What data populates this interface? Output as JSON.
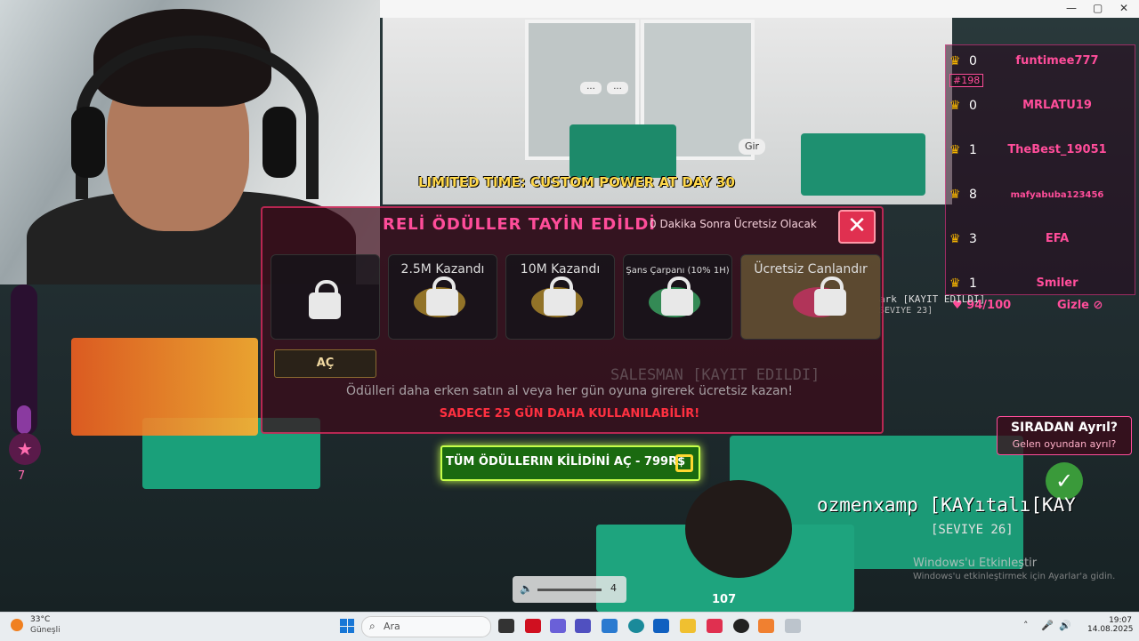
{
  "window": {
    "minimize": "—",
    "maximize": "▢",
    "close": "✕"
  },
  "leaderboard": {
    "rows": [
      {
        "score": "0",
        "name": "funtimee777",
        "rank": "#198"
      },
      {
        "score": "0",
        "name": "MRLATU19"
      },
      {
        "score": "1",
        "name": "TheBest_19051"
      },
      {
        "score": "8",
        "name": "mafyabuba123456"
      },
      {
        "score": "3",
        "name": "EFA"
      },
      {
        "score": "1",
        "name": "Smiler"
      }
    ]
  },
  "hud": {
    "stamina": "94/100",
    "hide_label": "Gizle",
    "star_count": "7",
    "leave_title": "SIRADAN Ayrıl?",
    "leave_sub": "Gelen oyundan ayrıl?",
    "player_name": "ozmenxamp [KAYıtalı[KAY",
    "player_level": "[SEVIYE 26]",
    "player_number": "107",
    "salesman_tag": "ark [KAYIT EDILDI]",
    "salesman_level": "SEVIYE 23]",
    "gir_label": "Gir"
  },
  "panel": {
    "title": "RELİ ÖDÜLLER TAYİN EDİLDİ",
    "subtitle": "0 Dakika Sonra Ücretsiz Olacak",
    "close": "✕",
    "rewards": [
      {
        "label": ""
      },
      {
        "label": "2.5M Kazandı"
      },
      {
        "label": "10M Kazandı"
      },
      {
        "label": "Şans Çarpanı (10% 1H)"
      },
      {
        "label": "Ücretsiz Canlandır"
      }
    ],
    "open_button": "AÇ",
    "ghost_text": "SALESMAN [KAYIT EDILDI]",
    "info": "Ödülleri daha erken satın al veya her gün oyuna girerek ücretsiz kazan!",
    "warning": "SADECE 25 GÜN DAHA KULLANILABİLİR!"
  },
  "banner": "LIMITED TIME: CUSTOM POWER AT DAY 30",
  "unlock_button": "TÜM ÖDÜLLERIN KİLİDİNİ AÇ - 799R$",
  "volume": {
    "value": "4"
  },
  "windows_notice": {
    "title": "Windows'u Etkinleştir",
    "sub": "Windows'u etkinleştirmek için Ayarlar'a gidin."
  },
  "taskbar": {
    "temp": "33°C",
    "weather": "Güneşli",
    "search": "Ara",
    "time": "19:07",
    "date": "14.08.2025"
  },
  "colors": {
    "accent": "#ff4d9a",
    "gold": "#ffd84a",
    "unlock_green": "#c6ff4a"
  }
}
